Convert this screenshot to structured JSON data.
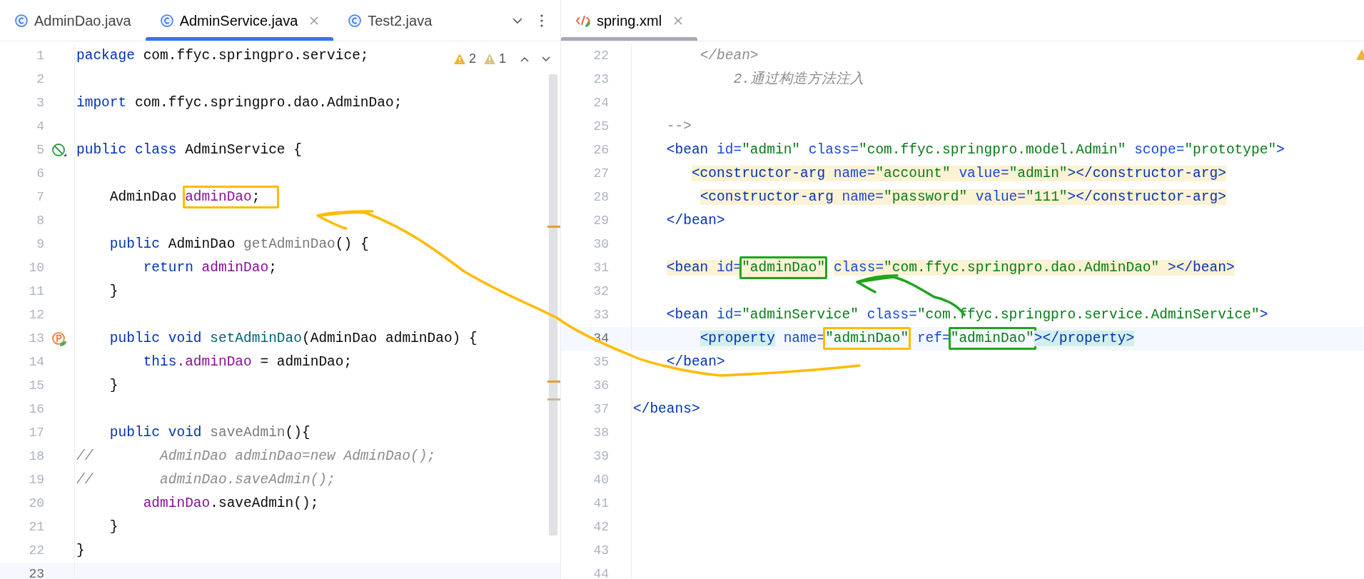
{
  "left_pane": {
    "tabs": [
      {
        "label": "AdminDao.java",
        "kind": "java",
        "selected": false
      },
      {
        "label": "AdminService.java",
        "kind": "java",
        "selected": true
      },
      {
        "label": "Test2.java",
        "kind": "java",
        "selected": false
      }
    ],
    "focused": true,
    "inspections": [
      {
        "kind": "warning",
        "count": "2"
      },
      {
        "kind": "weak_warning",
        "count": "1"
      }
    ],
    "lines": [
      {
        "number": "1",
        "current": false,
        "tokens": [
          {
            "kind": "kw",
            "text": "package"
          },
          {
            "kind": "plain",
            "text": " com.ffyc.springpro.service;"
          }
        ]
      },
      {
        "number": "2",
        "current": false
      },
      {
        "number": "3",
        "current": false,
        "tokens": [
          {
            "kind": "kw",
            "text": "import"
          },
          {
            "kind": "plain",
            "text": " com.ffyc.springpro.dao.AdminDao;"
          }
        ]
      },
      {
        "number": "4",
        "current": false
      },
      {
        "number": "5",
        "current": false,
        "marker": {
          "kind": "bean"
        },
        "tokens": [
          {
            "kind": "kw",
            "text": "public class"
          },
          {
            "kind": "plain",
            "text": " AdminService {"
          }
        ]
      },
      {
        "number": "6",
        "current": false
      },
      {
        "number": "7",
        "current": false,
        "tokens": [
          {
            "kind": "plain",
            "text": "    AdminDao "
          },
          {
            "kind": "box",
            "color": "#ffbb00",
            "tokens": [
              {
                "kind": "field",
                "text": "adminDao"
              },
              {
                "kind": "plain",
                "text": ";  "
              }
            ]
          }
        ]
      },
      {
        "number": "8",
        "current": false
      },
      {
        "number": "9",
        "current": false,
        "tokens": [
          {
            "kind": "kw",
            "text": "    public"
          },
          {
            "kind": "plain",
            "text": " AdminDao "
          },
          {
            "kind": "unused",
            "text": "getAdminDao"
          },
          {
            "kind": "plain",
            "text": "() {"
          }
        ]
      },
      {
        "number": "10",
        "current": false,
        "tokens": [
          {
            "kind": "kw",
            "text": "        return "
          },
          {
            "kind": "field",
            "text": "adminDao"
          },
          {
            "kind": "plain",
            "text": ";"
          }
        ]
      },
      {
        "number": "11",
        "current": false,
        "tokens": [
          {
            "kind": "plain",
            "text": "    }"
          }
        ]
      },
      {
        "number": "12",
        "current": false
      },
      {
        "number": "13",
        "current": false,
        "marker": {
          "kind": "property"
        },
        "tokens": [
          {
            "kind": "kw",
            "text": "    public void "
          },
          {
            "kind": "method",
            "text": "setAdminDao"
          },
          {
            "kind": "plain",
            "text": "(AdminDao adminDao) {"
          }
        ]
      },
      {
        "number": "14",
        "current": false,
        "tokens": [
          {
            "kind": "kw",
            "text": "        this"
          },
          {
            "kind": "field",
            "text": ".adminDao"
          },
          {
            "kind": "plain",
            "text": " = adminDao;"
          }
        ]
      },
      {
        "number": "15",
        "current": false,
        "tokens": [
          {
            "kind": "plain",
            "text": "    }"
          }
        ]
      },
      {
        "number": "16",
        "current": false
      },
      {
        "number": "17",
        "current": false,
        "tokens": [
          {
            "kind": "kw",
            "text": "    public void "
          },
          {
            "kind": "unused",
            "text": "saveAdmin"
          },
          {
            "kind": "plain",
            "text": "(){"
          }
        ]
      },
      {
        "number": "18",
        "current": false,
        "tokens": [
          {
            "kind": "comment",
            "text": "//        AdminDao adminDao=new AdminDao();"
          }
        ]
      },
      {
        "number": "19",
        "current": false,
        "tokens": [
          {
            "kind": "comment",
            "text": "//        adminDao.saveAdmin();"
          }
        ]
      },
      {
        "number": "20",
        "current": false,
        "tokens": [
          {
            "kind": "field",
            "text": "        adminDao"
          },
          {
            "kind": "plain",
            "text": ".saveAdmin();"
          }
        ]
      },
      {
        "number": "21",
        "current": false,
        "tokens": [
          {
            "kind": "plain",
            "text": "    }"
          }
        ]
      },
      {
        "number": "22",
        "current": false,
        "tokens": [
          {
            "kind": "plain",
            "text": "}"
          }
        ]
      },
      {
        "number": "23",
        "current": true
      }
    ]
  },
  "right_pane": {
    "tabs": [
      {
        "label": "spring.xml",
        "kind": "xml",
        "selected": true
      }
    ],
    "focused": false,
    "lines": [
      {
        "number": "22",
        "current": false,
        "tokens": [
          {
            "kind": "comment",
            "text": "        </bean>"
          }
        ]
      },
      {
        "number": "23",
        "current": false,
        "tokens": [
          {
            "kind": "comment",
            "text": "            2.通过构造方法注入"
          }
        ]
      },
      {
        "number": "24",
        "current": false
      },
      {
        "number": "25",
        "current": false,
        "tokens": [
          {
            "kind": "comment_plain",
            "text": "    -->"
          }
        ]
      },
      {
        "number": "26",
        "current": false,
        "tokens": [
          {
            "kind": "tag",
            "text": "    <bean "
          },
          {
            "kind": "attr",
            "text": "id="
          },
          {
            "kind": "value",
            "text": "\"admin\" "
          },
          {
            "kind": "attr",
            "text": "class="
          },
          {
            "kind": "value",
            "text": "\"com.ffyc.springpro.model.Admin\" "
          },
          {
            "kind": "attr",
            "text": "scope="
          },
          {
            "kind": "value",
            "text": "\"prototype\""
          },
          {
            "kind": "tag",
            "text": ">"
          }
        ]
      },
      {
        "number": "27",
        "current": false,
        "tokens": [
          {
            "kind": "highlight_element",
            "tokens": [
              {
                "kind": "tag",
                "text": "       <constructor-arg "
              },
              {
                "kind": "attr",
                "text": "name="
              },
              {
                "kind": "value",
                "text": "\"account\" "
              },
              {
                "kind": "attr",
                "text": "value="
              },
              {
                "kind": "value",
                "text": "\"admin\""
              },
              {
                "kind": "tag",
                "text": "></constructor-arg>"
              }
            ]
          }
        ]
      },
      {
        "number": "28",
        "current": false,
        "tokens": [
          {
            "kind": "highlight_element",
            "tokens": [
              {
                "kind": "tag",
                "text": "        <constructor-arg "
              },
              {
                "kind": "attr",
                "text": "name="
              },
              {
                "kind": "value",
                "text": "\"password\" "
              },
              {
                "kind": "attr",
                "text": "value="
              },
              {
                "kind": "value",
                "text": "\"111\""
              },
              {
                "kind": "tag",
                "text": "></constructor-arg>"
              }
            ]
          }
        ]
      },
      {
        "number": "29",
        "current": false,
        "tokens": [
          {
            "kind": "tag",
            "text": "    </bean>"
          }
        ]
      },
      {
        "number": "30",
        "current": false
      },
      {
        "number": "31",
        "current": false,
        "tokens": [
          {
            "kind": "highlight_element",
            "tokens": [
              {
                "kind": "tag",
                "text": "    <bean "
              },
              {
                "kind": "attr",
                "text": "id="
              },
              {
                "kind": "box",
                "color": "#1fa51f",
                "tokens": [
                  {
                    "kind": "value",
                    "text": "\"adminDao\""
                  }
                ]
              },
              {
                "kind": "attr",
                "text": " class="
              },
              {
                "kind": "value",
                "text": "\"com.ffyc.springpro.dao.AdminDao\" "
              },
              {
                "kind": "tag",
                "text": "></bean>"
              }
            ]
          }
        ]
      },
      {
        "number": "32",
        "current": false
      },
      {
        "number": "33",
        "current": false,
        "tokens": [
          {
            "kind": "tag",
            "text": "    <bean "
          },
          {
            "kind": "attr",
            "text": "id="
          },
          {
            "kind": "value",
            "text": "\"adminService\" "
          },
          {
            "kind": "attr",
            "text": "class="
          },
          {
            "kind": "value",
            "text": "\"com.ffyc.springpro.service.AdminService\""
          },
          {
            "kind": "tag",
            "text": ">"
          }
        ]
      },
      {
        "number": "34",
        "current": true,
        "tokens": [
          {
            "kind": "highlight_tag",
            "tokens": [
              {
                "kind": "tag",
                "text": "        <property"
              }
            ]
          },
          {
            "kind": "attr",
            "text": " name="
          },
          {
            "kind": "box",
            "color": "#ffbb00",
            "tokens": [
              {
                "kind": "value",
                "text": "\"adminDao\""
              }
            ]
          },
          {
            "kind": "attr",
            "text": " ref="
          },
          {
            "kind": "box",
            "color": "#1fa51f",
            "tokens": [
              {
                "kind": "value",
                "text": "\"adminDao\""
              }
            ]
          },
          {
            "kind": "highlight_tag",
            "tokens": [
              {
                "kind": "tag",
                "text": "></property>"
              }
            ]
          }
        ]
      },
      {
        "number": "35",
        "current": false,
        "tokens": [
          {
            "kind": "tag",
            "text": "    </bean>"
          }
        ]
      },
      {
        "number": "36",
        "current": false
      },
      {
        "number": "37",
        "current": false,
        "tokens": [
          {
            "kind": "tag",
            "text": "</beans>"
          }
        ]
      },
      {
        "number": "38",
        "current": false
      },
      {
        "number": "39",
        "current": false
      },
      {
        "number": "40",
        "current": false
      },
      {
        "number": "41",
        "current": false
      },
      {
        "number": "42",
        "current": false
      },
      {
        "number": "43",
        "current": false
      },
      {
        "number": "44",
        "current": false
      }
    ]
  }
}
